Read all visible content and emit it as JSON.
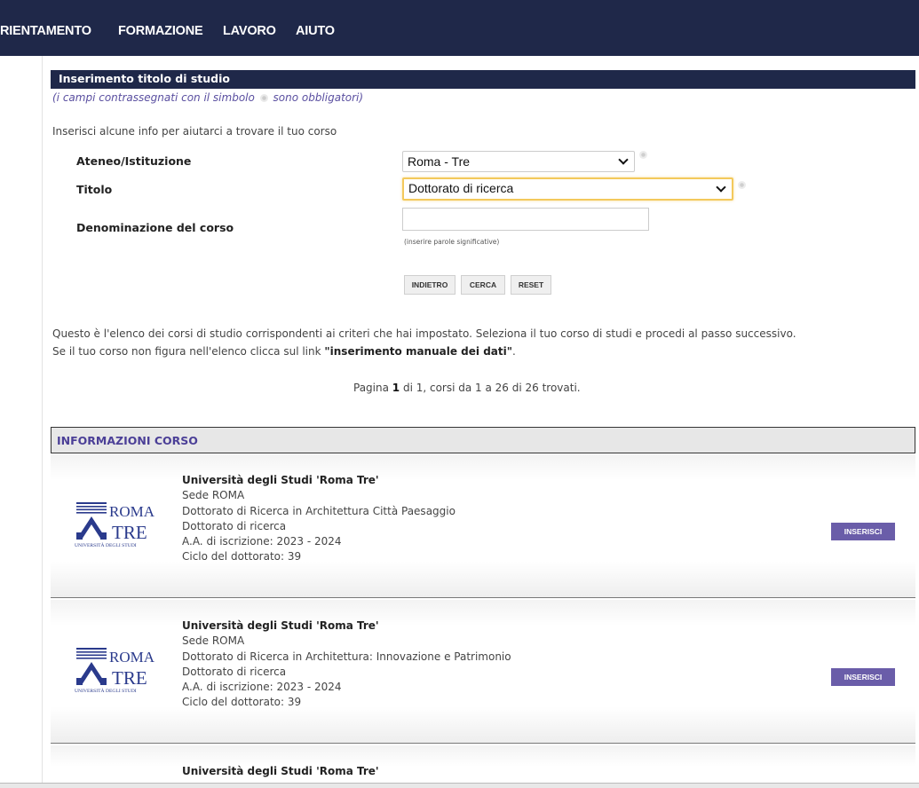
{
  "nav": {
    "items": [
      "RIENTAMENTO",
      "FORMAZIONE",
      "LAVORO",
      "AIUTO"
    ]
  },
  "form": {
    "title": "Inserimento titolo di studio",
    "required_note_before": "(i campi contrassegnati con il simbolo",
    "required_note_after": "sono obbligatori)",
    "intro": "Inserisci alcune info per aiutarci a trovare il tuo corso",
    "ateneo_label": "Ateneo/Istituzione",
    "ateneo_value": "Roma - Tre",
    "titolo_label": "Titolo",
    "titolo_value": "Dottorato di ricerca",
    "denominazione_label": "Denominazione del corso",
    "denominazione_value": "",
    "denominazione_hint": "(inserire parole significative)",
    "buttons": {
      "back": "INDIETRO",
      "search": "CERCA",
      "reset": "RESET"
    }
  },
  "results": {
    "line1": "Questo è l'elenco dei corsi di studio corrispondenti ai criteri che hai impostato. Seleziona il tuo corso di studi e procedi al passo successivo.",
    "line2_before": "Se il tuo corso non figura nell'elenco clicca sul link ",
    "line2_link": "\"inserimento manuale dei dati\"",
    "line2_after": ".",
    "pager_before": "Pagina ",
    "pager_page": "1",
    "pager_after": " di 1, corsi da 1 a 26 di 26 trovati.",
    "header": "INFORMAZIONI CORSO"
  },
  "logo_text": {
    "line1": "ROMA",
    "line2": "TRE",
    "line3": "UNIVERSITÀ DEGLI STUDI"
  },
  "courses": [
    {
      "university": "Università degli Studi 'Roma Tre'",
      "sede": "Sede ROMA",
      "corso": "Dottorato di Ricerca in Architettura Città Paesaggio",
      "tipo": "Dottorato di ricerca",
      "aa": "A.A. di iscrizione: 2023 - 2024",
      "ciclo": "Ciclo del dottorato: 39",
      "button": "INSERISCI"
    },
    {
      "university": "Università degli Studi 'Roma Tre'",
      "sede": "Sede ROMA",
      "corso": "Dottorato di Ricerca in Architettura: Innovazione e Patrimonio",
      "tipo": "Dottorato di ricerca",
      "aa": "A.A. di iscrizione: 2023 - 2024",
      "ciclo": "Ciclo del dottorato: 39",
      "button": "INSERISCI"
    },
    {
      "university": "Università degli Studi 'Roma Tre'"
    }
  ],
  "colors": {
    "nav_bg": "#1f2849",
    "accent": "#6a5da9",
    "focus": "#f3c95c"
  }
}
